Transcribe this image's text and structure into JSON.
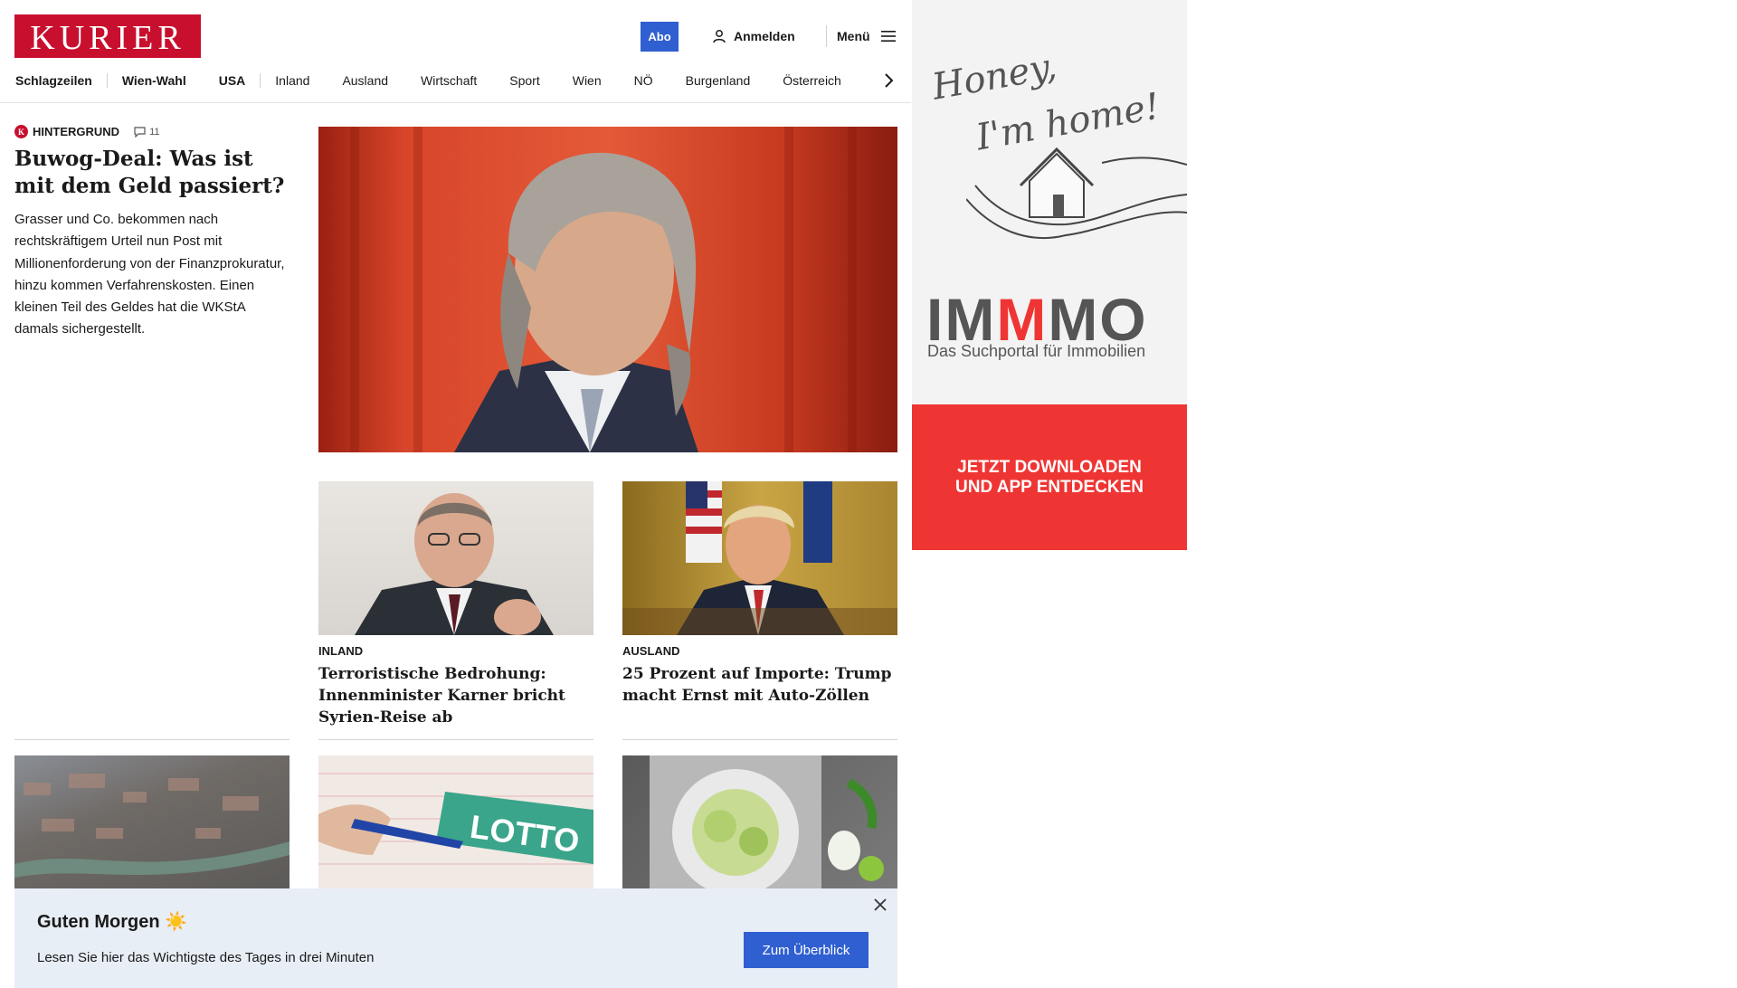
{
  "header": {
    "logo": "KURIER",
    "abo_label": "Abo",
    "login_label": "Anmelden",
    "menu_label": "Menü"
  },
  "nav": {
    "items": [
      "Schlagzeilen",
      "Wien-Wahl",
      "USA",
      "Inland",
      "Ausland",
      "Wirtschaft",
      "Sport",
      "Wien",
      "NÖ",
      "Burgenland",
      "Österreich"
    ]
  },
  "hero": {
    "kicker": "HINTERGRUND",
    "comments": "11",
    "title": "Buwog-Deal: Was ist mit dem Geld passiert?",
    "lead": "Grasser und Co. bekommen nach rechtskräftigem Urteil nun Post mit Millionenforderung von der Finanzprokuratur, hinzu kommen Verfahrenskosten. Einen kleinen Teil des Geldes hat die WKStA damals sichergestellt."
  },
  "articles": [
    {
      "category": "INLAND",
      "title": "Terroristische Bedrohung: Innenminister Karner bricht Syrien-Reise ab"
    },
    {
      "category": "AUSLAND",
      "title": "25 Prozent auf Importe: Trump macht Ernst mit Auto-Zöllen"
    }
  ],
  "ad": {
    "script_line1": "Honey,",
    "script_line2": "I'm home!",
    "brand_a": "IM",
    "brand_m": "M",
    "brand_b": "MO",
    "tagline": "Das Suchportal für Immobilien",
    "cta_line1": "JETZT DOWNLOADEN",
    "cta_line2": "UND APP ENTDECKEN"
  },
  "lotto_label": "LOTTO",
  "banner": {
    "title": "Guten Morgen ☀️",
    "subtitle": "Lesen Sie hier das Wichtigste des Tages in drei Minuten",
    "button": "Zum Überblick"
  },
  "colors": {
    "brand_red": "#c8102e",
    "accent_blue": "#2f5fd0",
    "ad_red": "#ef3533",
    "banner_bg": "#e8eef6"
  }
}
